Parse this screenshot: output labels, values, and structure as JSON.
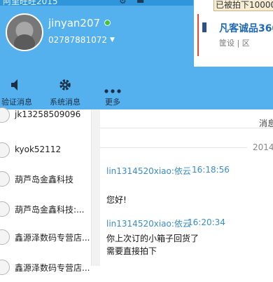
{
  "app": {
    "title": "阿里旺旺2015"
  },
  "profile": {
    "username": "jinyan207",
    "phone": "02787881072",
    "status_color": "#3fc43a"
  },
  "ad": {
    "banner": "已被拍下10000",
    "store_name": "凡客诚品360",
    "store_sub": "筐设 | 区"
  },
  "toolbar": {
    "items": [
      {
        "label": "验证消息",
        "icon": "speaker-icon"
      },
      {
        "label": "系统消息",
        "icon": "gear-icon"
      },
      {
        "label": "更多",
        "icon": "more-dots-icon"
      }
    ]
  },
  "contacts": [
    {
      "name": "jk13258509096"
    },
    {
      "name": "kyok52112"
    },
    {
      "name": "葫芦岛金鑫科技"
    },
    {
      "name": "葫芦岛金鑫科技:..."
    },
    {
      "name": "鑫源泽数码专营店..."
    },
    {
      "name": "鑫源泽数码专营店..."
    }
  ],
  "chat": {
    "header_partial": "消息",
    "date_partial": "2014",
    "messages": [
      {
        "sender": "lin1314520xiao:依云",
        "time": "16:18:56",
        "lines": [
          "您好!"
        ]
      },
      {
        "sender": "lin1314520xiao:依云",
        "time": "16:20:34",
        "lines": [
          "你上次订的小箱子回货了",
          "需要直接拍下"
        ]
      }
    ]
  },
  "colors": {
    "header_bg": "#54b1ee",
    "link_blue": "#3a8cc8"
  }
}
